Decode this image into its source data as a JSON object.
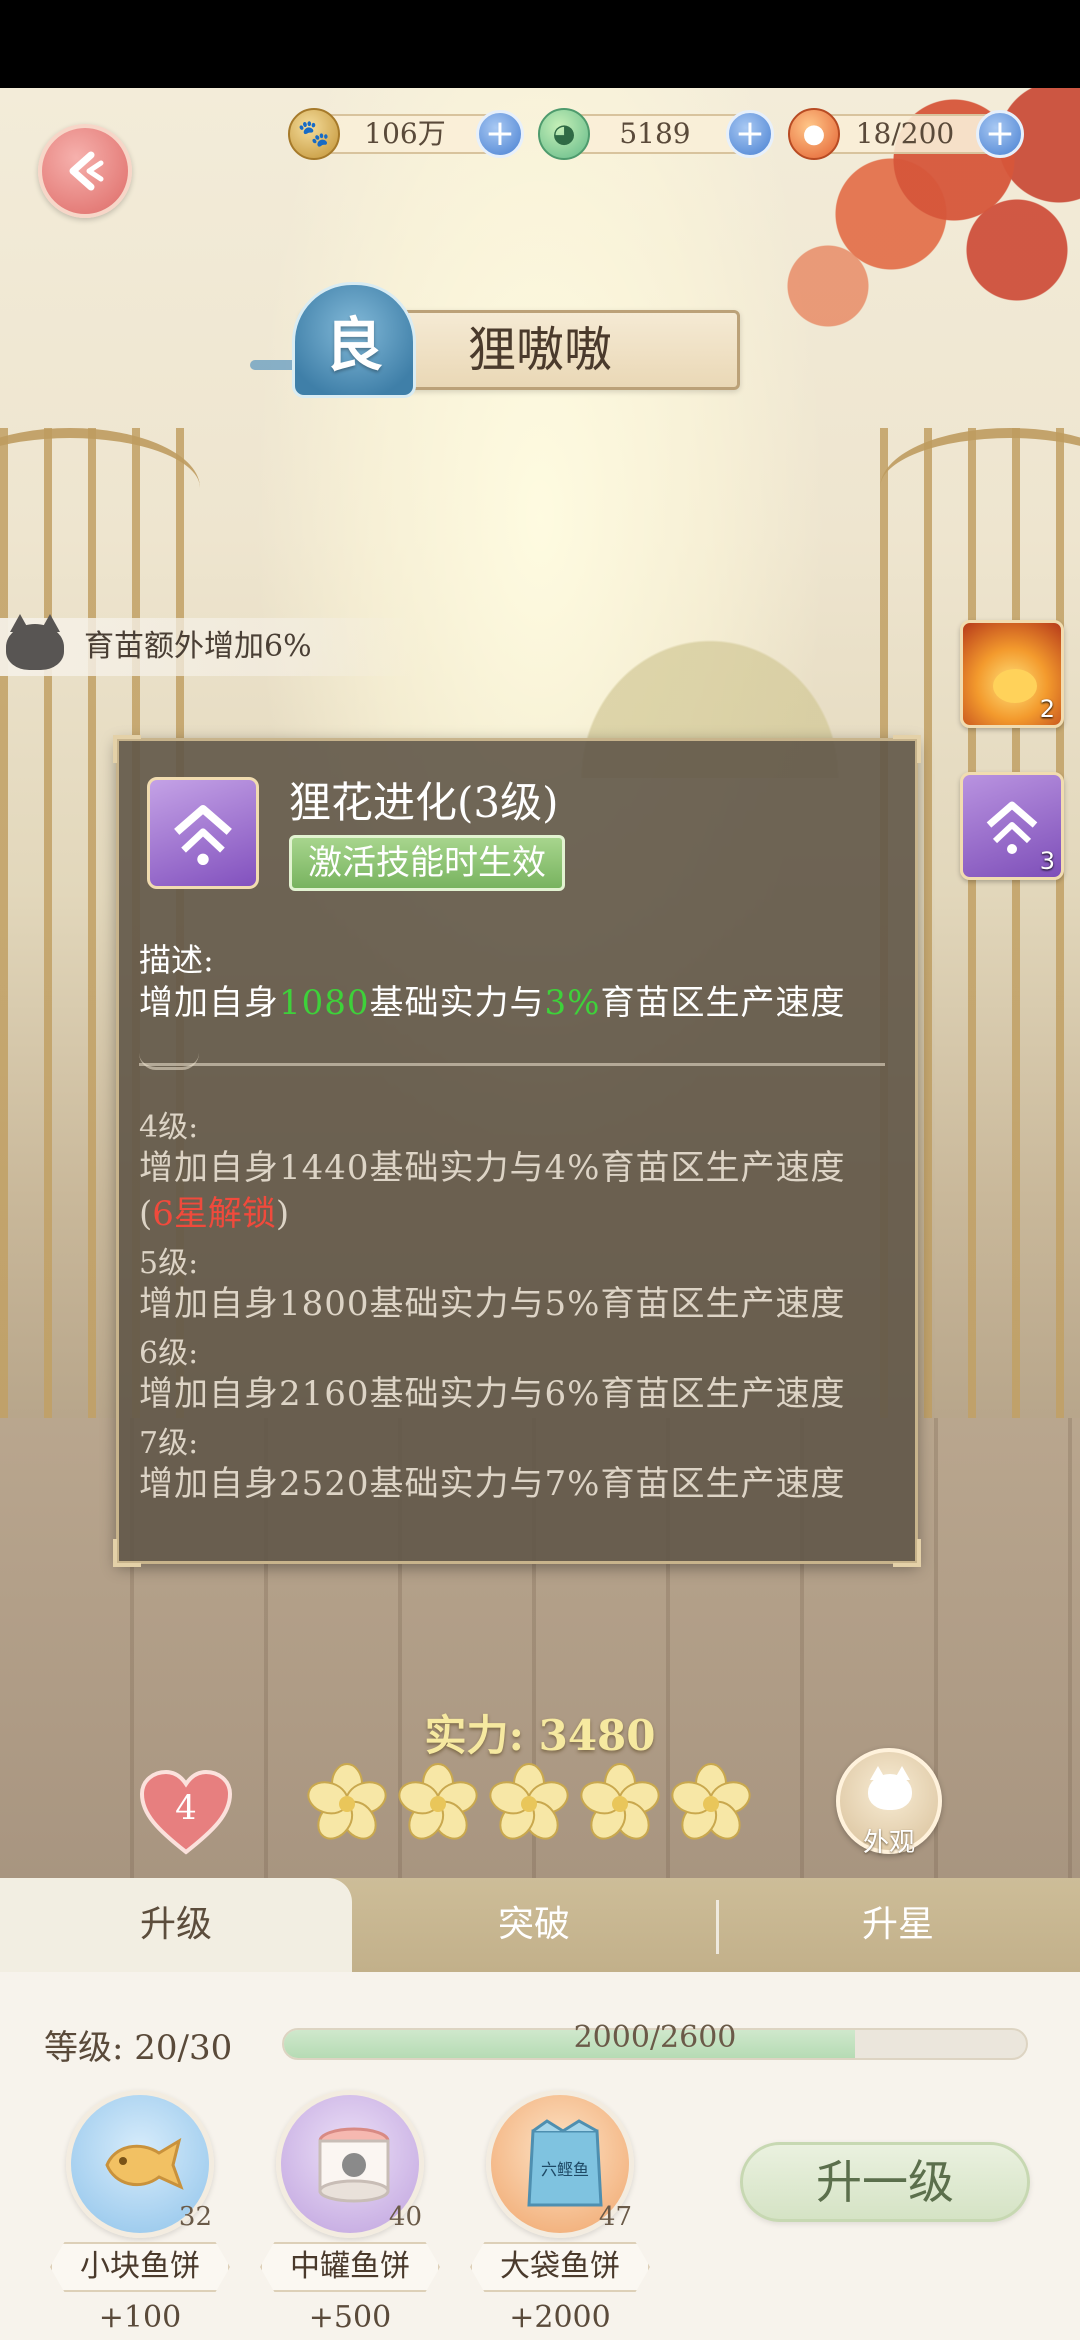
{
  "resources": {
    "coins": "106万",
    "fish": "5189",
    "food": "18/200"
  },
  "pet": {
    "rarity": "良",
    "name": "狸嗷嗷",
    "buff": "育苗额外增加6%"
  },
  "side_skills": [
    {
      "icon": "fire-spirit-icon",
      "level": "2"
    },
    {
      "icon": "purple-evolve-icon",
      "level": "3"
    }
  ],
  "skill": {
    "title": "狸花进化(3级)",
    "tag": "激活技能时生效",
    "desc_label": "描述:",
    "desc_parts": [
      "增加自身",
      "1080",
      "基础实力与",
      "3%",
      "育苗区生产速度"
    ],
    "levels": [
      {
        "name": "4级:",
        "desc": "增加自身1440基础实力与4%育苗区生产速度",
        "lock_open": "(",
        "lock": "6星解锁",
        "lock_close": ")"
      },
      {
        "name": "5级:",
        "desc": "增加自身1800基础实力与5%育苗区生产速度"
      },
      {
        "name": "6级:",
        "desc": "增加自身2160基础实力与6%育苗区生产速度"
      },
      {
        "name": "7级:",
        "desc": "增加自身2520基础实力与7%育苗区生产速度"
      }
    ]
  },
  "power": "实力: 3480",
  "heart_count": "4",
  "stars": {
    "filled": 5,
    "total": 5
  },
  "appearance_label": "外观",
  "tabs": [
    "升级",
    "突破",
    "升星"
  ],
  "level": {
    "label": "等级: 20/30",
    "xp_text": "2000/2600",
    "xp_progress": 0.769
  },
  "items": [
    {
      "name": "小块鱼饼",
      "count": "32",
      "bonus": "+100"
    },
    {
      "name": "中罐鱼饼",
      "count": "40",
      "bonus": "+500"
    },
    {
      "name": "大袋鱼饼",
      "count": "47",
      "bonus": "+2000",
      "bag_text": "六鲣鱼"
    }
  ],
  "upgrade_button": "升一级",
  "colors": {
    "highlight_green": "#3ed13a",
    "lock_red": "#f04a3c",
    "power_gold": "#f6e9a0"
  }
}
